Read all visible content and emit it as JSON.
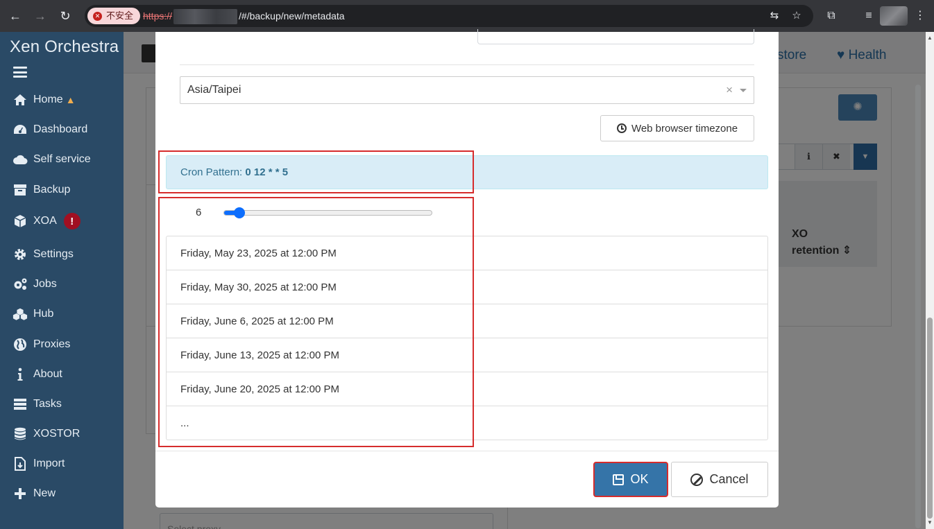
{
  "browser": {
    "security_label": "不安全",
    "url_scheme": "https://",
    "url_path": "/#/backup/new/metadata"
  },
  "sidebar": {
    "brand": "Xen Orchestra",
    "items": [
      {
        "label": "Home",
        "icon": "home-icon"
      },
      {
        "label": "Dashboard",
        "icon": "dashboard-icon"
      },
      {
        "label": "Self service",
        "icon": "cloud-icon"
      },
      {
        "label": "Backup",
        "icon": "archive-icon"
      },
      {
        "label": "XOA",
        "icon": "cube-icon"
      },
      {
        "label": "Settings",
        "icon": "gear-icon"
      },
      {
        "label": "Jobs",
        "icon": "gears-icon"
      },
      {
        "label": "Hub",
        "icon": "cubes-icon"
      },
      {
        "label": "Proxies",
        "icon": "globe-icon"
      },
      {
        "label": "About",
        "icon": "info-icon"
      },
      {
        "label": "Tasks",
        "icon": "tasks-icon"
      },
      {
        "label": "XOSTOR",
        "icon": "database-icon"
      },
      {
        "label": "Import",
        "icon": "import-file-icon"
      },
      {
        "label": "New",
        "icon": "plus-icon"
      }
    ],
    "xoa_badge": "!"
  },
  "background": {
    "tab_restore": "store",
    "tab_health": "Health",
    "th_line1": "XO",
    "th_line2": "retention",
    "select_proxy_placeholder": "Select proxy"
  },
  "modal": {
    "timezone": "Asia/Taipei",
    "browser_tz_button": "Web browser timezone",
    "cron_label": "Cron Pattern: ",
    "cron_value": "0 12 * * 5",
    "slider_value": 6,
    "slider_min": 1,
    "slider_max": 100,
    "occurrences": [
      "Friday, May 23, 2025 at 12:00 PM",
      "Friday, May 30, 2025 at 12:00 PM",
      "Friday, June 6, 2025 at 12:00 PM",
      "Friday, June 13, 2025 at 12:00 PM",
      "Friday, June 20, 2025 at 12:00 PM",
      "..."
    ],
    "ok_label": "OK",
    "cancel_label": "Cancel"
  },
  "colors": {
    "sidebar_bg": "#2a4a66",
    "primary": "#3574a8",
    "info_bg": "#d9edf7",
    "highlight": "#d62c2c"
  }
}
